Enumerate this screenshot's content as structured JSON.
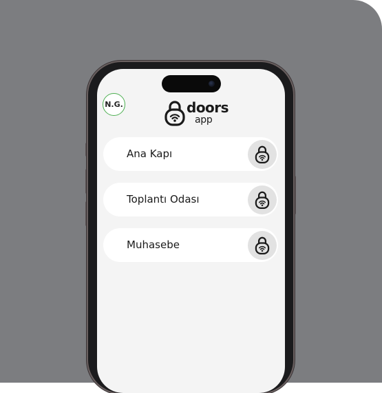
{
  "user": {
    "initials": "N.G."
  },
  "brand": {
    "name_line1": "doors",
    "name_line2": "app"
  },
  "doors": [
    {
      "name": "Ana Kapı"
    },
    {
      "name": "Toplantı Odası"
    },
    {
      "name": "Muhasebe"
    }
  ],
  "icons": {
    "logo": "padlock-wifi-icon",
    "door_action": "padlock-wifi-icon"
  },
  "colors": {
    "background": "#7c7d80",
    "screen": "#f4f4f4",
    "card": "#ffffff",
    "lock_button": "#e2e2e2",
    "avatar_border": "#4caf50",
    "text": "#1a1a1a"
  }
}
